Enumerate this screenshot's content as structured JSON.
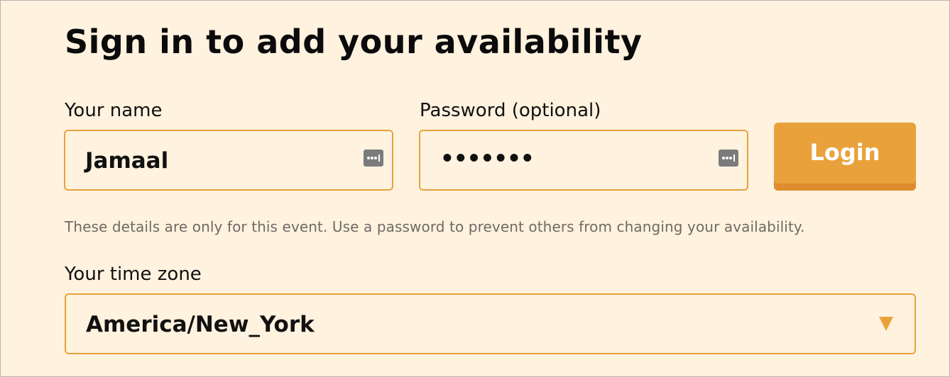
{
  "form": {
    "title": "Sign in to add your availability",
    "name_label": "Your name",
    "name_value": "Jamaal",
    "password_label": "Password (optional)",
    "password_value": "•••••••",
    "login_label": "Login",
    "helper_text": "These details are only for this event. Use a password to prevent others from changing your availability.",
    "timezone_label": "Your time zone",
    "timezone_value": "America/New_York"
  },
  "icons": {
    "name_field_icon": "password-manager-icon",
    "password_field_icon": "password-manager-icon",
    "select_icon": "chevron-down-icon"
  },
  "colors": {
    "background": "#fff2df",
    "accent": "#e9a23b",
    "accent_dark": "#e08b2f",
    "text": "#111111",
    "helper_text": "#6f6a63",
    "icon_gray": "#7b7b7b"
  }
}
